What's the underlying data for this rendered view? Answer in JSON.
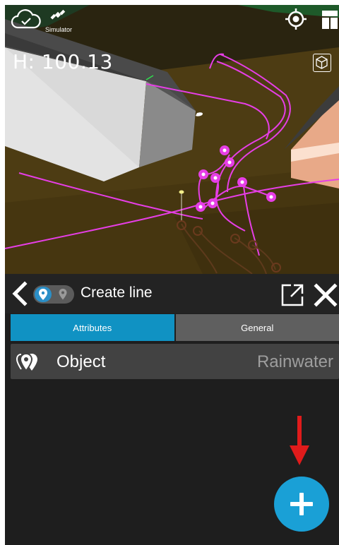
{
  "map": {
    "height_readout": "H: 100.13",
    "simulator_label": "Simulator"
  },
  "toolbar": {
    "title": "Create line"
  },
  "tabs": [
    {
      "label": "Attributes",
      "active": true
    },
    {
      "label": "General",
      "active": false
    }
  ],
  "attribute_row": {
    "label": "Object",
    "value": "Rainwater"
  },
  "colors": {
    "accent": "#1092c3",
    "fab": "#1aa0d6",
    "line_magenta": "#e63ee6",
    "annotation_arrow": "#e01b1b"
  },
  "icons": [
    "cloud-check-icon",
    "satellite-icon",
    "gps-target-icon",
    "layers-icon",
    "cube-icon",
    "back-chevron-icon",
    "map-pin-icon",
    "open-external-icon",
    "close-icon",
    "pins-icon",
    "plus-icon"
  ]
}
